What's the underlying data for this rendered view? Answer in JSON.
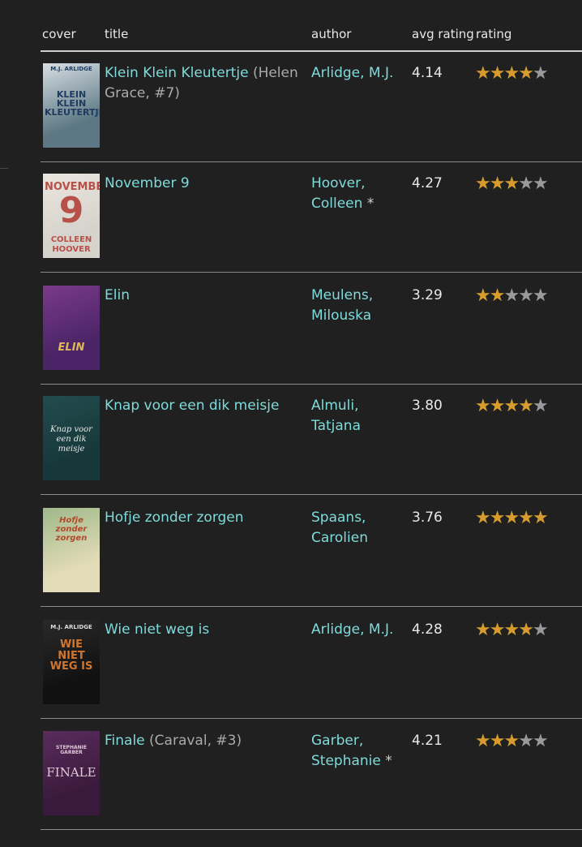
{
  "header": {
    "cover": "cover",
    "title": "title",
    "author": "author",
    "avg_rating": "avg rating",
    "rating": "rating"
  },
  "colors": {
    "link": "#7fdbdb",
    "star_on": "#d69c2f",
    "star_off": "#9a9a9a",
    "background": "#202020"
  },
  "books": [
    {
      "title": "Klein Klein Kleutertje",
      "series": "(Helen Grace, #7)",
      "author": "Arlidge, M.J.",
      "author_mark": "",
      "avg_rating": "4.14",
      "stars": 4,
      "cover": {
        "top_text": "M.J. ARLIDGE",
        "title_text": "KLEIN KLEIN KLEUTERTJE",
        "bg": "#5d7884",
        "fg": "#1e3a5e",
        "panel": "#d7dee3"
      }
    },
    {
      "title": "November 9",
      "series": "",
      "author": "Hoover, Colleen",
      "author_mark": "*",
      "avg_rating": "4.27",
      "stars": 3,
      "cover": {
        "top_text": "NOVEMBER",
        "title_text": "9",
        "bottom_text": "COLLEEN HOOVER",
        "bg": "#d6d2cc",
        "fg": "#b8504a",
        "panel": "#eae6df"
      }
    },
    {
      "title": "Elin",
      "series": "",
      "author": "Meulens, Milouska",
      "author_mark": "",
      "avg_rating": "3.29",
      "stars": 2,
      "cover": {
        "title_text": "ELIN",
        "bg": "#4a2466",
        "fg": "#e0b85a",
        "panel": "#7a3a8a"
      }
    },
    {
      "title": "Knap voor een dik meisje",
      "series": "",
      "author": "Almuli, Tatjana",
      "author_mark": "",
      "avg_rating": "3.80",
      "stars": 4,
      "cover": {
        "title_text": "Knap voor een dik meisje",
        "bg": "#17383a",
        "fg": "#e8e8e8",
        "panel": "#224c4e"
      }
    },
    {
      "title": "Hofje zonder zorgen",
      "series": "",
      "author": "Spaans, Carolien",
      "author_mark": "",
      "avg_rating": "3.76",
      "stars": 5,
      "cover": {
        "title_text": "Hofje zonder zorgen",
        "bg": "#e3dcb8",
        "fg": "#b04a2a",
        "panel": "#9fb88a"
      }
    },
    {
      "title": "Wie niet weg is",
      "series": "",
      "author": "Arlidge, M.J.",
      "author_mark": "",
      "avg_rating": "4.28",
      "stars": 4,
      "cover": {
        "top_text": "M.J. ARLIDGE",
        "title_text": "WIE NIET WEG IS",
        "bg": "#111111",
        "fg": "#d2762e",
        "panel": "#2a2a2a"
      }
    },
    {
      "title": "Finale",
      "series": "(Caraval, #3)",
      "author": "Garber, Stephanie",
      "author_mark": "*",
      "avg_rating": "4.21",
      "stars": 3,
      "cover": {
        "top_text": "STEPHANIE GARBER",
        "title_text": "FINALE",
        "bg": "#3a1a3c",
        "fg": "#e0c8d8",
        "panel": "#5a2c5c"
      }
    }
  ]
}
